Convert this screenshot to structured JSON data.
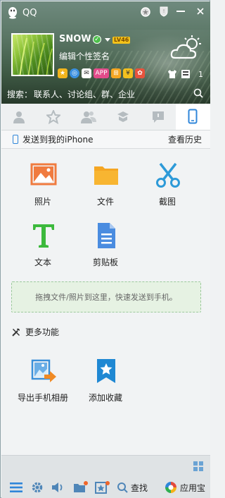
{
  "window": {
    "app_title": "QQ"
  },
  "profile": {
    "nickname": "SNOW",
    "level_badge": "LV46",
    "signature": "编辑个性签名",
    "online_status": "online"
  },
  "search": {
    "label": "搜索：",
    "placeholder": "联系人、讨论组、群、企业"
  },
  "tabs": [
    {
      "name": "contacts",
      "icon": "person-icon"
    },
    {
      "name": "favorites",
      "icon": "star-icon"
    },
    {
      "name": "groups",
      "icon": "group-icon"
    },
    {
      "name": "discussion",
      "icon": "cube-icon"
    },
    {
      "name": "messages",
      "icon": "chat-icon"
    },
    {
      "name": "phone",
      "icon": "phone-icon",
      "active": true
    }
  ],
  "send_panel": {
    "title": "发送到我的iPhone",
    "history_link": "查看历史",
    "items": [
      {
        "label": "照片",
        "icon": "photo-icon"
      },
      {
        "label": "文件",
        "icon": "folder-icon"
      },
      {
        "label": "截图",
        "icon": "scissors-icon"
      },
      {
        "label": "文本",
        "icon": "text-icon"
      },
      {
        "label": "剪贴板",
        "icon": "document-icon"
      }
    ],
    "dropzone_text": "拖拽文件/照片到这里，快速发送到手机。"
  },
  "more": {
    "title": "更多功能",
    "items": [
      {
        "label": "导出手机相册",
        "icon": "export-album-icon"
      },
      {
        "label": "添加收藏",
        "icon": "bookmark-icon"
      }
    ]
  },
  "toolbar": {
    "find_label": "查找",
    "appstore_label": "应用宝"
  },
  "colors": {
    "accent_blue": "#2f86d9",
    "photo_orange": "#f07b3f",
    "folder_yellow": "#f5a623",
    "text_green": "#3cb93c",
    "dropzone_bg": "#e6f2e3"
  }
}
